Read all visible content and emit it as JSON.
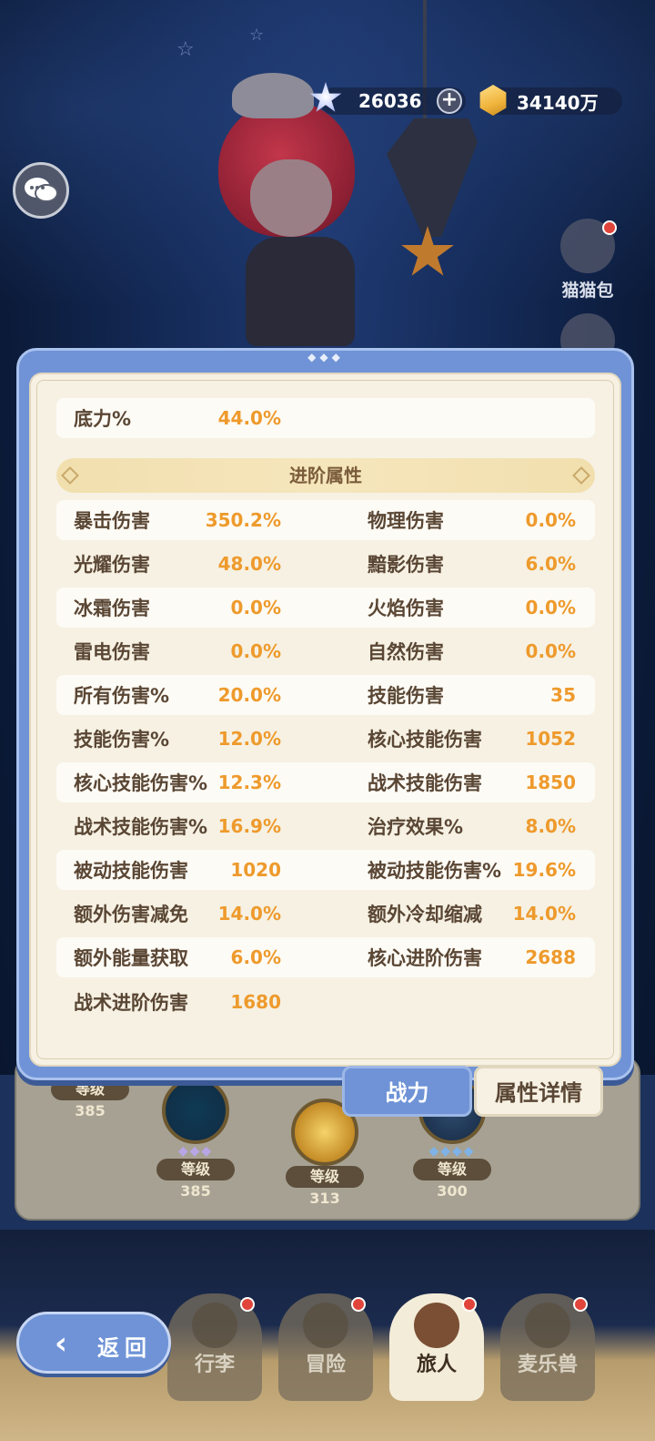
{
  "currency": {
    "gems": "26036",
    "gems_add": "+",
    "coins": "34140万"
  },
  "side_menu": {
    "bag_label": "猫猫包"
  },
  "panel": {
    "top_row": {
      "label": "底力%",
      "value": "44.0%"
    },
    "section_title": "进阶属性",
    "rows": [
      {
        "left_label": "暴击伤害",
        "left_value": "350.2%",
        "right_label": "物理伤害",
        "right_value": "0.0%"
      },
      {
        "left_label": "光耀伤害",
        "left_value": "48.0%",
        "right_label": "黯影伤害",
        "right_value": "6.0%"
      },
      {
        "left_label": "冰霜伤害",
        "left_value": "0.0%",
        "right_label": "火焰伤害",
        "right_value": "0.0%"
      },
      {
        "left_label": "雷电伤害",
        "left_value": "0.0%",
        "right_label": "自然伤害",
        "right_value": "0.0%"
      },
      {
        "left_label": "所有伤害%",
        "left_value": "20.0%",
        "right_label": "技能伤害",
        "right_value": "35"
      },
      {
        "left_label": "技能伤害%",
        "left_value": "12.0%",
        "right_label": "核心技能伤害",
        "right_value": "1052"
      },
      {
        "left_label": "核心技能伤害%",
        "left_value": "12.3%",
        "right_label": "战术技能伤害",
        "right_value": "1850"
      },
      {
        "left_label": "战术技能伤害%",
        "left_value": "16.9%",
        "right_label": "治疗效果%",
        "right_value": "8.0%"
      },
      {
        "left_label": "被动技能伤害",
        "left_value": "1020",
        "right_label": "被动技能伤害%",
        "right_value": "19.6%"
      },
      {
        "left_label": "额外伤害减免",
        "left_value": "14.0%",
        "right_label": "额外冷却缩减",
        "right_value": "14.0%"
      },
      {
        "left_label": "额外能量获取",
        "left_value": "6.0%",
        "right_label": "核心进阶伤害",
        "right_value": "2688"
      },
      {
        "left_label": "战术进阶伤害",
        "left_value": "1680",
        "right_label": "",
        "right_value": ""
      }
    ]
  },
  "tabs": {
    "power": "战力",
    "detail": "属性详情"
  },
  "skills": [
    {
      "level": "等级385"
    },
    {
      "level": "等级385"
    },
    {
      "level": "等级313"
    },
    {
      "level": "等级300"
    }
  ],
  "nav": {
    "back": "返回",
    "items": [
      "行李",
      "冒险",
      "旅人",
      "麦乐兽"
    ]
  }
}
